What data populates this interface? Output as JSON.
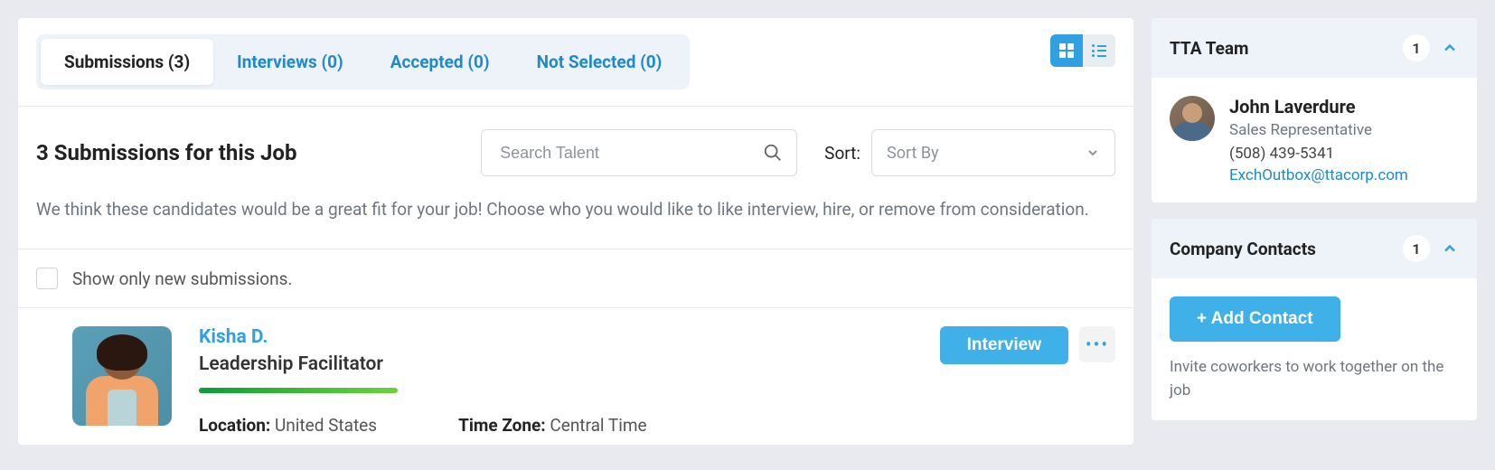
{
  "tabs": {
    "submissions": "Submissions (3)",
    "interviews": "Interviews (0)",
    "accepted": "Accepted (0)",
    "not_selected": "Not Selected (0)"
  },
  "heading": "3 Submissions for this Job",
  "search": {
    "placeholder": "Search Talent"
  },
  "sort": {
    "label": "Sort:",
    "placeholder": "Sort By"
  },
  "description": "We think these candidates would be a great fit for your job! Choose who you would like to like interview, hire, or remove from consideration.",
  "filter": {
    "label": "Show only new submissions."
  },
  "candidate": {
    "name": "Kisha D.",
    "role": "Leadership Facilitator",
    "location_label": "Location:",
    "location_value": "United States",
    "timezone_label": "Time Zone:",
    "timezone_value": "Central Time",
    "action_primary": "Interview"
  },
  "tta_team": {
    "title": "TTA Team",
    "count": "1",
    "member": {
      "name": "John Laverdure",
      "role": "Sales Representative",
      "phone": "(508) 439-5341",
      "email": "ExchOutbox@ttacorp.com"
    }
  },
  "company_contacts": {
    "title": "Company Contacts",
    "count": "1",
    "add_button": "+ Add Contact",
    "invite_text": "Invite coworkers to work together on the job"
  }
}
